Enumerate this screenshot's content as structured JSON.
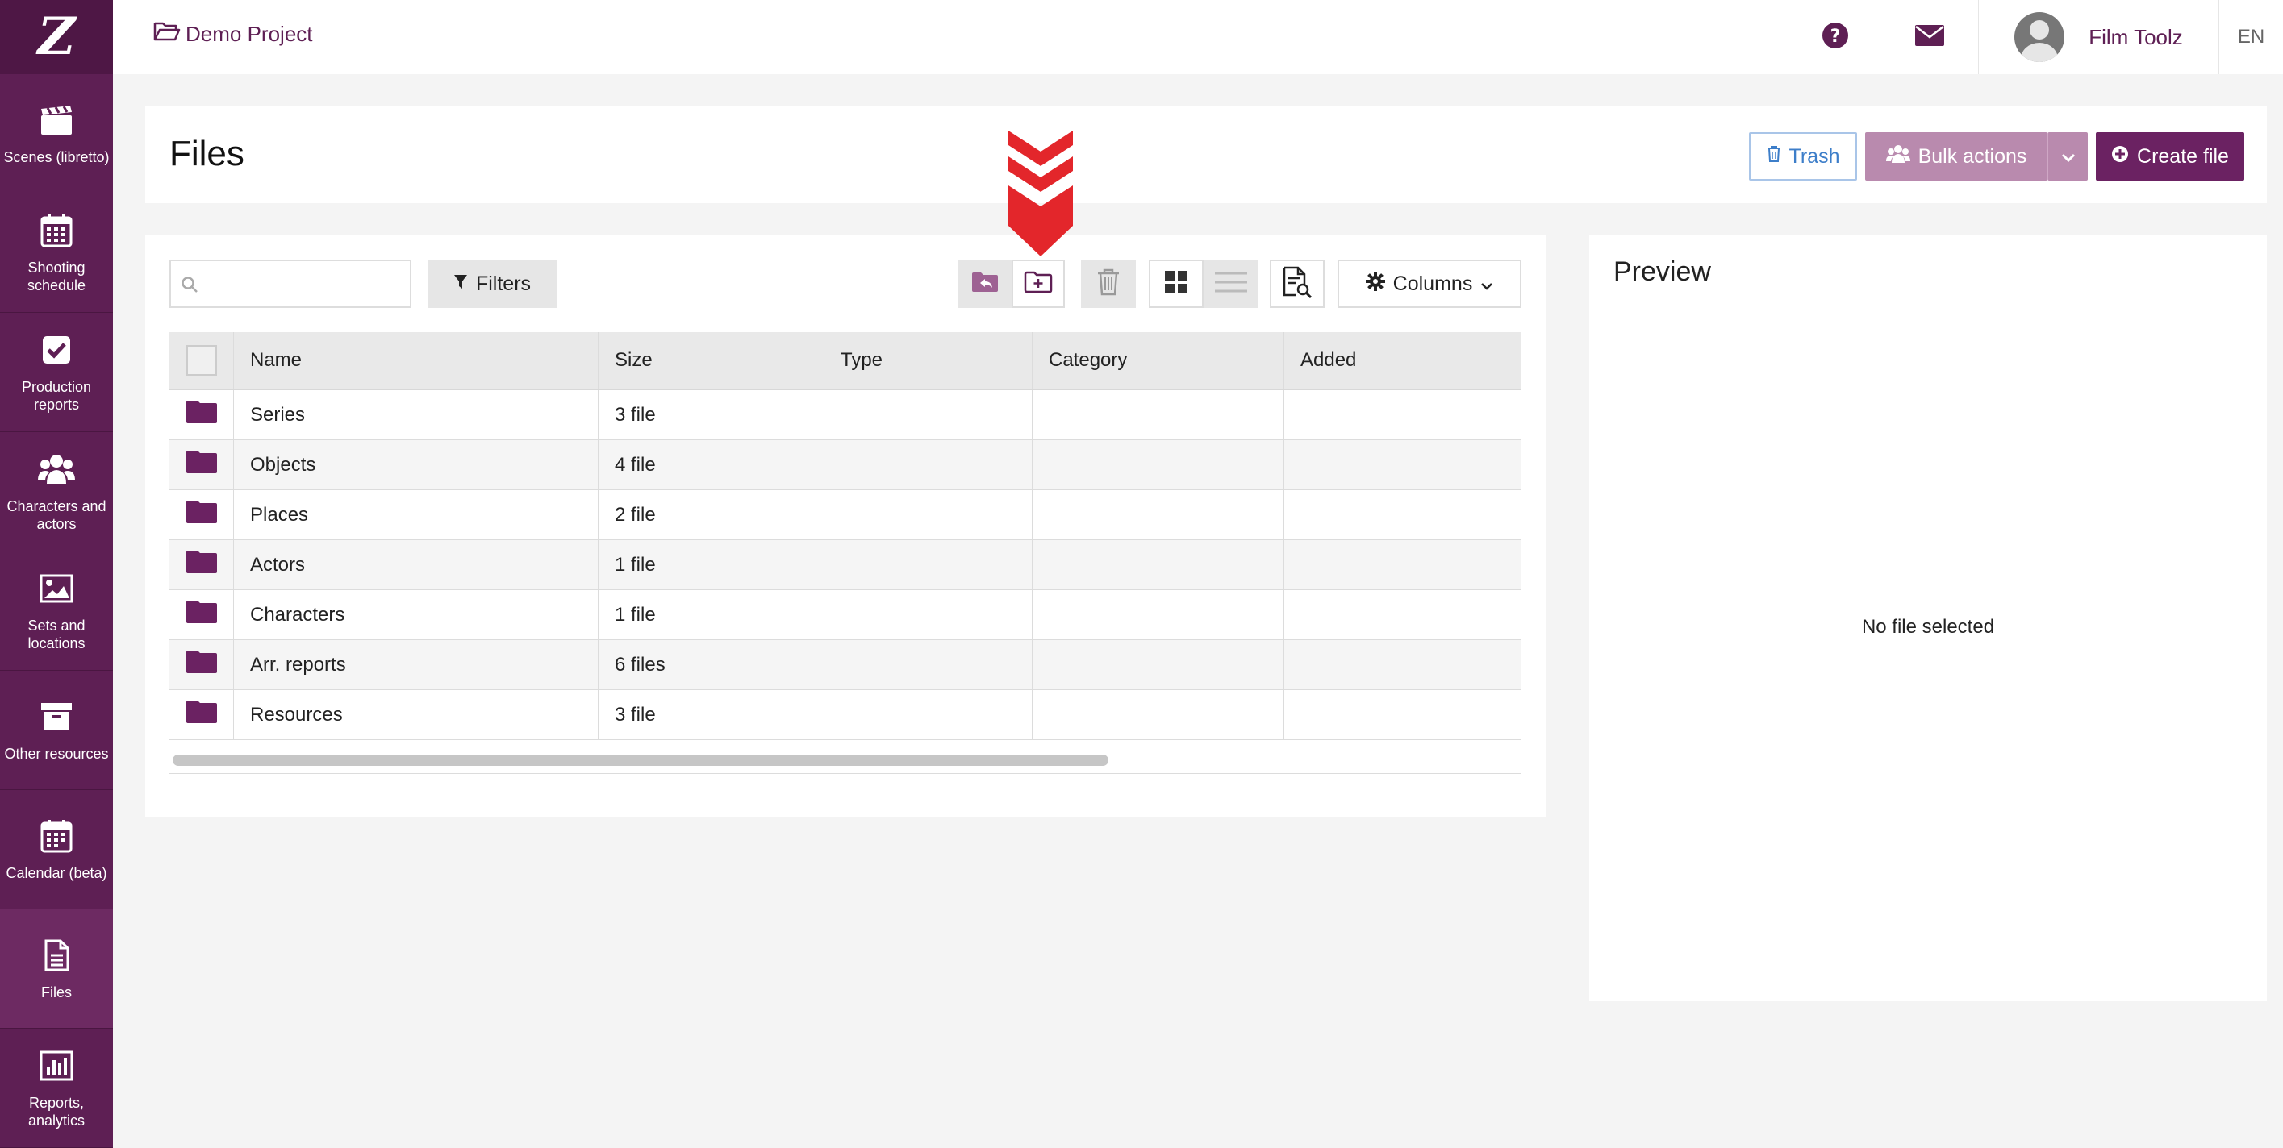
{
  "colors": {
    "brand": "#5e1f54",
    "brand_light": "#b98aae",
    "accent_red": "#e3262b"
  },
  "sidebar": {
    "logo": "Z",
    "items": [
      {
        "label": "Scenes (libretto)",
        "icon": "clapperboard-icon"
      },
      {
        "label": "Shooting schedule",
        "icon": "calendar-grid-icon"
      },
      {
        "label": "Production reports",
        "icon": "checkbox-icon"
      },
      {
        "label": "Characters and actors",
        "icon": "users-icon"
      },
      {
        "label": "Sets and locations",
        "icon": "image-icon"
      },
      {
        "label": "Other resources",
        "icon": "archive-box-icon"
      },
      {
        "label": "Calendar (beta)",
        "icon": "calendar-icon"
      },
      {
        "label": "Files",
        "icon": "document-icon"
      },
      {
        "label": "Reports, analytics",
        "icon": "bar-chart-icon"
      }
    ]
  },
  "topbar": {
    "project": "Demo Project",
    "user_name": "Film Toolz",
    "language": "EN"
  },
  "header": {
    "title": "Files",
    "trash_label": "Trash",
    "bulk_label": "Bulk actions",
    "create_label": "Create file"
  },
  "toolbar": {
    "search_placeholder": "",
    "filters_label": "Filters",
    "columns_label": "Columns"
  },
  "table": {
    "columns": [
      "Name",
      "Size",
      "Type",
      "Category",
      "Added"
    ],
    "rows": [
      {
        "name": "Series",
        "size": "3 file",
        "type": "",
        "category": "",
        "added": ""
      },
      {
        "name": "Objects",
        "size": "4 file",
        "type": "",
        "category": "",
        "added": ""
      },
      {
        "name": "Places",
        "size": "2 file",
        "type": "",
        "category": "",
        "added": ""
      },
      {
        "name": "Actors",
        "size": "1 file",
        "type": "",
        "category": "",
        "added": ""
      },
      {
        "name": "Characters",
        "size": "1 file",
        "type": "",
        "category": "",
        "added": ""
      },
      {
        "name": "Arr. reports",
        "size": "6 files",
        "type": "",
        "category": "",
        "added": ""
      },
      {
        "name": "Resources",
        "size": "3 file",
        "type": "",
        "category": "",
        "added": ""
      }
    ]
  },
  "preview": {
    "title": "Preview",
    "empty_text": "No file selected"
  }
}
